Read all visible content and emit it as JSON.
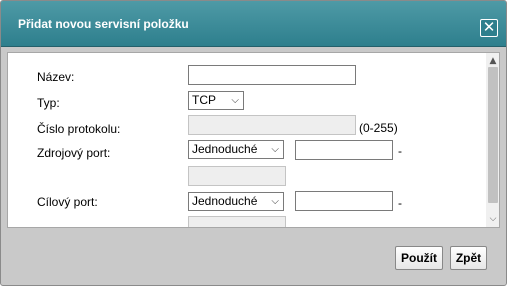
{
  "dialog": {
    "title": "Přidat novou servisní položku",
    "close_glyph": "✕"
  },
  "form": {
    "name_label": "Název:",
    "name_value": "",
    "type_label": "Typ:",
    "type_value": "TCP",
    "protocol_label": "Číslo protokolu:",
    "protocol_value": "",
    "protocol_hint": "(0-255)",
    "source_port_label": "Zdrojový port:",
    "source_port_mode": "Jednoduché",
    "source_port_from": "",
    "source_port_to": "",
    "dest_port_label": "Cílový port:",
    "dest_port_mode": "Jednoduché",
    "dest_port_from": "",
    "dest_port_to": "",
    "range_dash": "-"
  },
  "buttons": {
    "apply": "Použít",
    "back": "Zpět"
  },
  "icons": {
    "chevron": "chevron-down-icon",
    "close": "close-icon"
  },
  "colors": {
    "titlebar": "#2e7f8d",
    "frame": "#c9c9c9"
  }
}
